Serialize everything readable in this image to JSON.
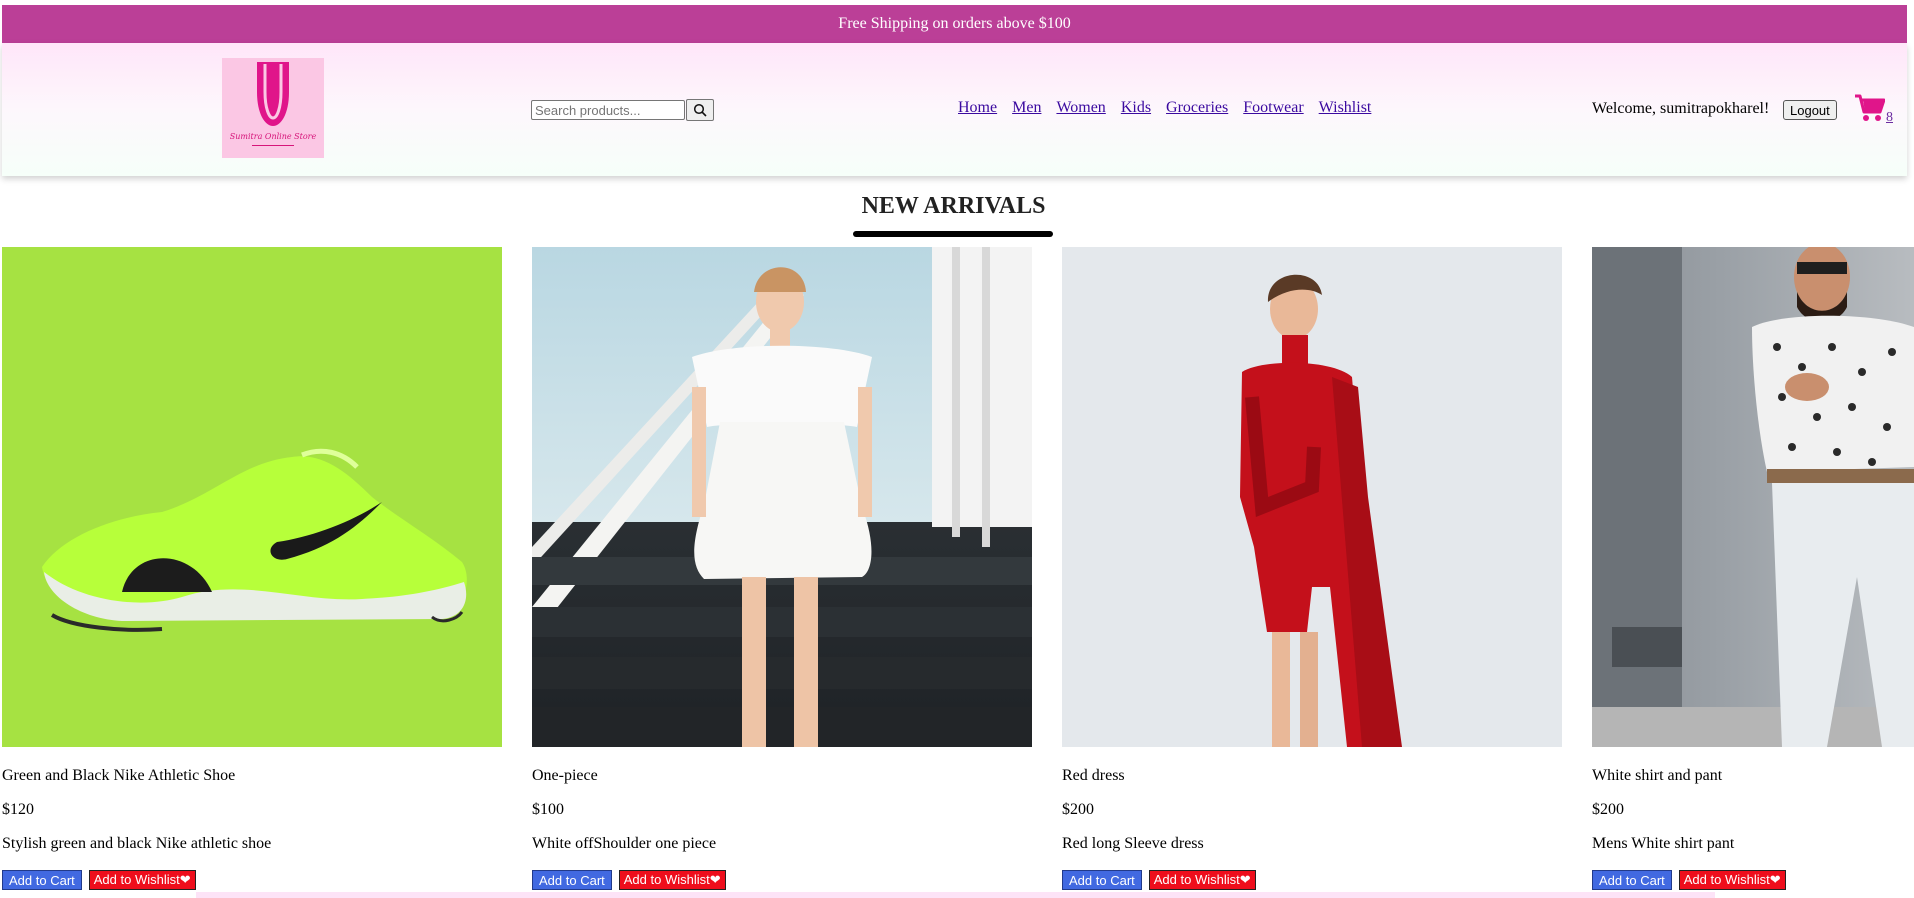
{
  "promo": {
    "text": "Free Shipping on orders above $100"
  },
  "header": {
    "logo_alt": "Sumitra Online Store",
    "search_placeholder": "Search products...",
    "nav": [
      "Home",
      "Men",
      "Women",
      "Kids",
      "Groceries",
      "Footwear",
      "Wishlist"
    ],
    "welcome": "Welcome, sumitrapokharel!",
    "logout_label": "Logout",
    "cart_count": "8"
  },
  "section": {
    "title": "NEW ARRIVALS"
  },
  "products": [
    {
      "name": "Green and Black Nike Athletic Shoe",
      "price": "$120",
      "description": "Stylish green and black Nike athletic shoe",
      "add_to_cart": "Add to Cart",
      "add_to_wishlist": "Add to Wishlist❤"
    },
    {
      "name": "One-piece",
      "price": "$100",
      "description": "White offShoulder one piece",
      "add_to_cart": "Add to Cart",
      "add_to_wishlist": "Add to Wishlist❤"
    },
    {
      "name": "Red dress",
      "price": "$200",
      "description": "Red long Sleeve dress",
      "add_to_cart": "Add to Cart",
      "add_to_wishlist": "Add to Wishlist❤"
    },
    {
      "name": "White shirt and pant",
      "price": "$200",
      "description": "Mens White shirt pant",
      "add_to_cart": "Add to Cart",
      "add_to_wishlist": "Add to Wishlist❤"
    }
  ],
  "colors": {
    "promo_bg": "#bb3f97",
    "brand_pink": "#e0158a",
    "cart_button": "#4169e1",
    "wishlist_button": "#ee0e1c",
    "shoe_bg": "#a6e242"
  }
}
